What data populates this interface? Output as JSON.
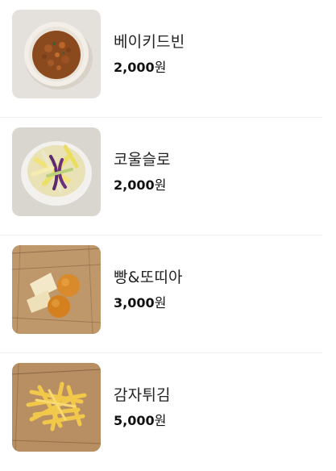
{
  "menu": {
    "items": [
      {
        "name": "베이키드빈",
        "price": "2,000",
        "currency": "원",
        "image": "baked-beans-image"
      },
      {
        "name": "코울슬로",
        "price": "2,000",
        "currency": "원",
        "image": "coleslaw-image"
      },
      {
        "name": "빵&또띠아",
        "price": "3,000",
        "currency": "원",
        "image": "bread-tortilla-image"
      },
      {
        "name": "감자튀김",
        "price": "5,000",
        "currency": "원",
        "image": "french-fries-image"
      }
    ]
  }
}
